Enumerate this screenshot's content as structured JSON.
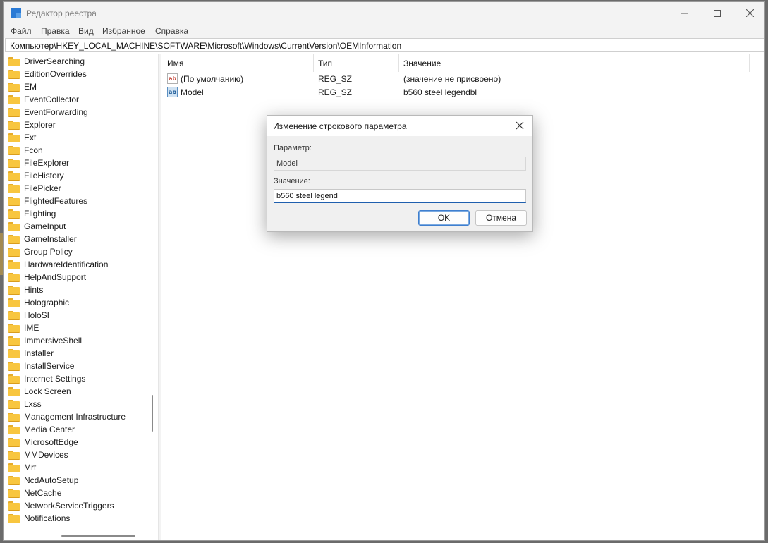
{
  "window": {
    "title": "Редактор реестра",
    "minimize_icon": "minimize-icon",
    "maximize_icon": "maximize-icon",
    "close_icon": "close-icon"
  },
  "menu": [
    "Файл",
    "Правка",
    "Вид",
    "Избранное",
    "Справка"
  ],
  "address": "Компьютер\\HKEY_LOCAL_MACHINE\\SOFTWARE\\Microsoft\\Windows\\CurrentVersion\\OEMInformation",
  "tree": {
    "items": [
      "DriverSearching",
      "EditionOverrides",
      "EM",
      "EventCollector",
      "EventForwarding",
      "Explorer",
      "Ext",
      "Fcon",
      "FileExplorer",
      "FileHistory",
      "FilePicker",
      "FlightedFeatures",
      "Flighting",
      "GameInput",
      "GameInstaller",
      "Group Policy",
      "HardwareIdentification",
      "HelpAndSupport",
      "Hints",
      "Holographic",
      "HoloSI",
      "IME",
      "ImmersiveShell",
      "Installer",
      "InstallService",
      "Internet Settings",
      "Lock Screen",
      "Lxss",
      "Management Infrastructure",
      "Media Center",
      "MicrosoftEdge",
      "MMDevices",
      "Mrt",
      "NcdAutoSetup",
      "NetCache",
      "NetworkServiceTriggers",
      "Notifications"
    ]
  },
  "list": {
    "columns": [
      "Имя",
      "Тип",
      "Значение"
    ],
    "rows": [
      {
        "name": "(По умолчанию)",
        "type": "REG_SZ",
        "value": "(значение не присвоено)"
      },
      {
        "name": "Model",
        "type": "REG_SZ",
        "value": "b560 steel legendbl"
      }
    ],
    "value_icon_text": "ab"
  },
  "dialog": {
    "title": "Изменение строкового параметра",
    "param_label": "Параметр:",
    "param_value": "Model",
    "value_label": "Значение:",
    "value_input": "b560 steel legend",
    "ok_label": "OK",
    "cancel_label": "Отмена"
  }
}
